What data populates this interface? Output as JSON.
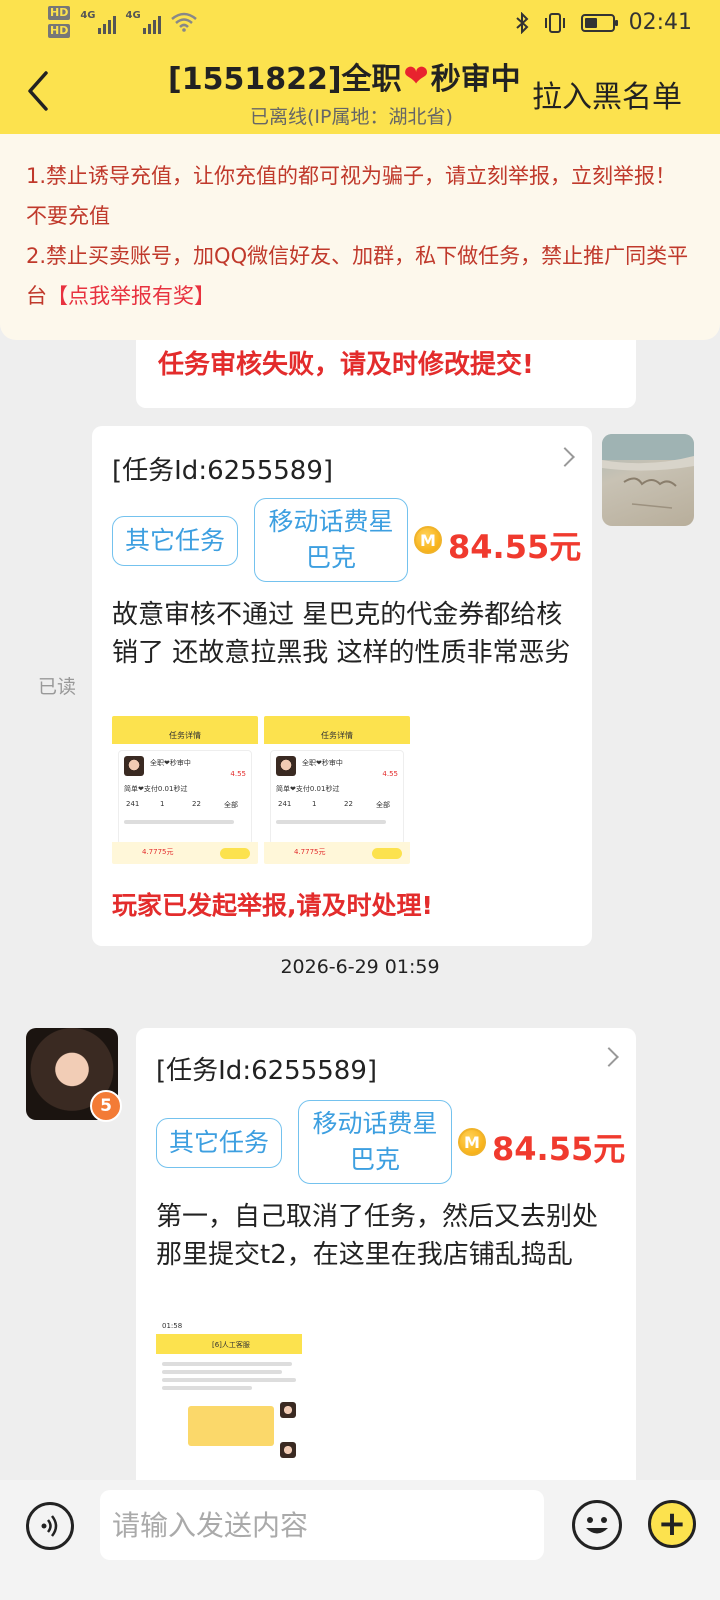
{
  "status_bar": {
    "hd1": "HD",
    "hd2": "HD",
    "sim1_network": "4G",
    "sim2_network": "4G",
    "time": "02:41",
    "battery_percent": 45
  },
  "header": {
    "back_icon": "chevron-left-icon",
    "title_prefix": "[1551822]全职",
    "title_heart": "❤",
    "title_suffix": "秒审中",
    "subtitle": "已离线(IP属地：湖北省)",
    "blacklist_label": "拉入黑名单"
  },
  "notice": {
    "line1": "1.禁止诱导充值，让你充值的都可视为骗子，请立刻举报，立刻举报！不要充值",
    "line2": "2.禁止买卖账号，加QQ微信好友、加群，私下做任务，禁止推广同类平台",
    "report_link": "【点我举报有奖】"
  },
  "chat": {
    "fail_message": "任务审核失败，请及时修改提交!",
    "read_label": "已读",
    "timestamp": "2026-6-29 01:59",
    "message1": {
      "task_id": "[任务Id:6255589]",
      "tag1": "其它任务",
      "tag2": "移动话费星巴克",
      "coin_letter": "M",
      "price": "84.55元",
      "text": "故意审核不通过 星巴克的代金券都给核销了 还故意拉黑我 这样的性质非常恶劣",
      "report_text": "玩家已发起举报,请及时处理!",
      "thumb": {
        "title": "任务详情",
        "name": "全职❤秒审中",
        "price": "4.55",
        "desc": "简单❤支付0.01秒过",
        "stats": [
          "241",
          "1",
          "22",
          "全部"
        ],
        "bottom_price": "4.7775元"
      }
    },
    "message2": {
      "task_id": "[任务Id:6255589]",
      "tag1": "其它任务",
      "tag2": "移动话费星巴克",
      "coin_letter": "M",
      "price": "84.55元",
      "text": "第一，自己取消了任务，然后又去别处那里提交t2，在这里在我店铺乱捣乱",
      "level_badge": "5",
      "thumb": {
        "title": "[6]人工客服",
        "time": "01:58"
      }
    }
  },
  "input_bar": {
    "placeholder": "请输入发送内容",
    "voice_icon": "voice-icon",
    "emoji_icon": "emoji-icon",
    "plus_label": "+"
  },
  "colors": {
    "brand_yellow": "#fce24e",
    "alert_red": "#e32c2c",
    "tag_blue": "#3d9fe0",
    "chat_bg": "#eeeeee"
  }
}
